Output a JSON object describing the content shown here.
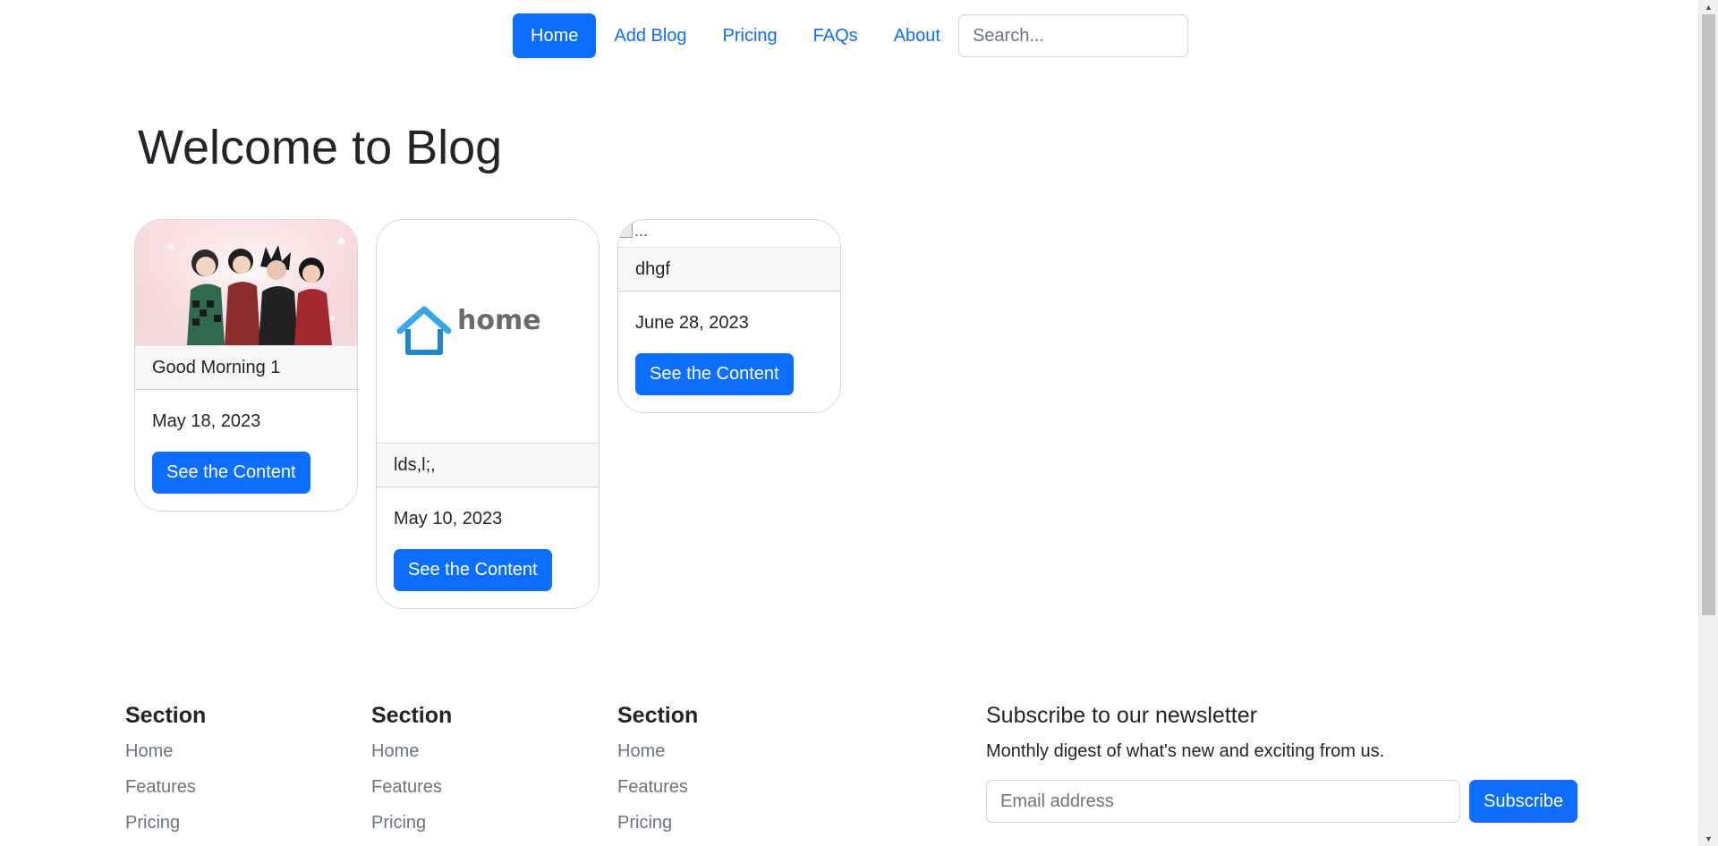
{
  "nav": {
    "items": [
      {
        "label": "Home",
        "active": true
      },
      {
        "label": "Add Blog"
      },
      {
        "label": "Pricing"
      },
      {
        "label": "FAQs"
      },
      {
        "label": "About"
      }
    ],
    "search_placeholder": "Search..."
  },
  "page_title": "Welcome to Blog",
  "cards": [
    {
      "title": "Good Morning 1",
      "date": "May 18, 2023",
      "button": "See the Content",
      "image": "anime-group-illustration"
    },
    {
      "title": "lds,l;,",
      "date": "May 10, 2023",
      "button": "See the Content",
      "image": "home-logo",
      "logo_text": "home"
    },
    {
      "title": "dhgf",
      "date": "June 28, 2023",
      "button": "See the Content",
      "image": "broken-image",
      "image_alt": "..."
    }
  ],
  "footer": {
    "columns": [
      {
        "heading": "Section",
        "links": [
          "Home",
          "Features",
          "Pricing"
        ]
      },
      {
        "heading": "Section",
        "links": [
          "Home",
          "Features",
          "Pricing"
        ]
      },
      {
        "heading": "Section",
        "links": [
          "Home",
          "Features",
          "Pricing"
        ]
      }
    ],
    "newsletter": {
      "heading": "Subscribe to our newsletter",
      "description": "Monthly digest of what's new and exciting from us.",
      "email_placeholder": "Email address",
      "button": "Subscribe"
    }
  },
  "colors": {
    "primary": "#0d6efd",
    "muted": "#6c757d",
    "text": "#212529"
  }
}
